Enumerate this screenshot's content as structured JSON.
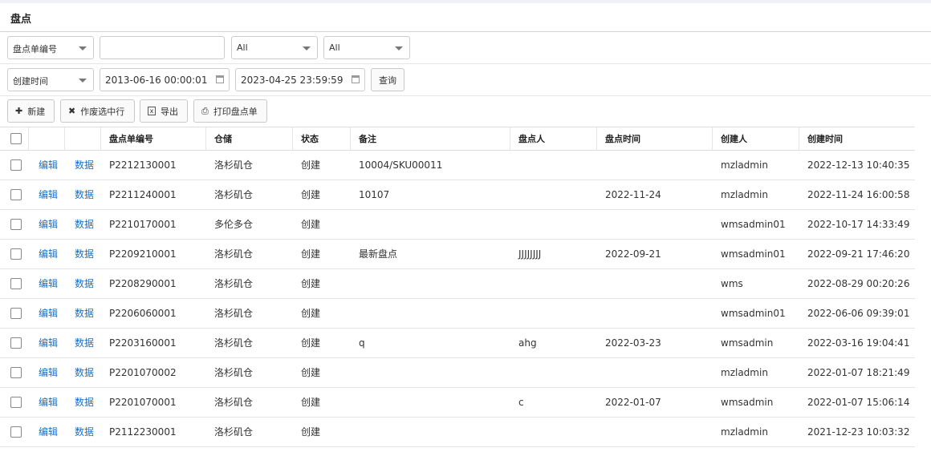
{
  "page": {
    "title": "盘点"
  },
  "filters": {
    "row1": {
      "field_select": "盘点单编号",
      "search_value": "",
      "select2": "All",
      "select3": "All"
    },
    "row2": {
      "date_field_select": "创建时间",
      "date_from": "2013-06-16 00:00:01",
      "date_to": "2023-04-25 23:59:59",
      "query_label": "查询"
    }
  },
  "toolbar": {
    "new_label": "新建",
    "void_label": "作废选中行",
    "export_label": "导出",
    "print_label": "打印盘点单"
  },
  "table": {
    "columns": [
      "盘点单编号",
      "仓储",
      "状态",
      "备注",
      "盘点人",
      "盘点时间",
      "创建人",
      "创建时间"
    ],
    "edit_label": "编辑",
    "data_label": "数据",
    "rows": [
      {
        "no": "P2212130001",
        "warehouse": "洛杉矶仓",
        "status": "创建",
        "remark": "10004/SKU00011",
        "counter": "",
        "count_time": "",
        "creator": "mzladmin",
        "created": "2022-12-13 10:40:35"
      },
      {
        "no": "P2211240001",
        "warehouse": "洛杉矶仓",
        "status": "创建",
        "remark": "10107",
        "counter": "",
        "count_time": "2022-11-24",
        "creator": "mzladmin",
        "created": "2022-11-24 16:00:58"
      },
      {
        "no": "P2210170001",
        "warehouse": "多伦多仓",
        "status": "创建",
        "remark": "",
        "counter": "",
        "count_time": "",
        "creator": "wmsadmin01",
        "created": "2022-10-17 14:33:49"
      },
      {
        "no": "P2209210001",
        "warehouse": "洛杉矶仓",
        "status": "创建",
        "remark": "最新盘点",
        "counter": "JJJJJJJJ",
        "count_time": "2022-09-21",
        "creator": "wmsadmin01",
        "created": "2022-09-21 17:46:20"
      },
      {
        "no": "P2208290001",
        "warehouse": "洛杉矶仓",
        "status": "创建",
        "remark": "",
        "counter": "",
        "count_time": "",
        "creator": "wms",
        "created": "2022-08-29 00:20:26"
      },
      {
        "no": "P2206060001",
        "warehouse": "洛杉矶仓",
        "status": "创建",
        "remark": "",
        "counter": "",
        "count_time": "",
        "creator": "wmsadmin01",
        "created": "2022-06-06 09:39:01"
      },
      {
        "no": "P2203160001",
        "warehouse": "洛杉矶仓",
        "status": "创建",
        "remark": "q",
        "counter": "ahg",
        "count_time": "2022-03-23",
        "creator": "wmsadmin",
        "created": "2022-03-16 19:04:41"
      },
      {
        "no": "P2201070002",
        "warehouse": "洛杉矶仓",
        "status": "创建",
        "remark": "",
        "counter": "",
        "count_time": "",
        "creator": "mzladmin",
        "created": "2022-01-07 18:21:49"
      },
      {
        "no": "P2201070001",
        "warehouse": "洛杉矶仓",
        "status": "创建",
        "remark": "",
        "counter": "c",
        "count_time": "2022-01-07",
        "creator": "wmsadmin",
        "created": "2022-01-07 15:06:14"
      },
      {
        "no": "P2112230001",
        "warehouse": "洛杉矶仓",
        "status": "创建",
        "remark": "",
        "counter": "",
        "count_time": "",
        "creator": "mzladmin",
        "created": "2021-12-23 10:03:32"
      }
    ]
  }
}
